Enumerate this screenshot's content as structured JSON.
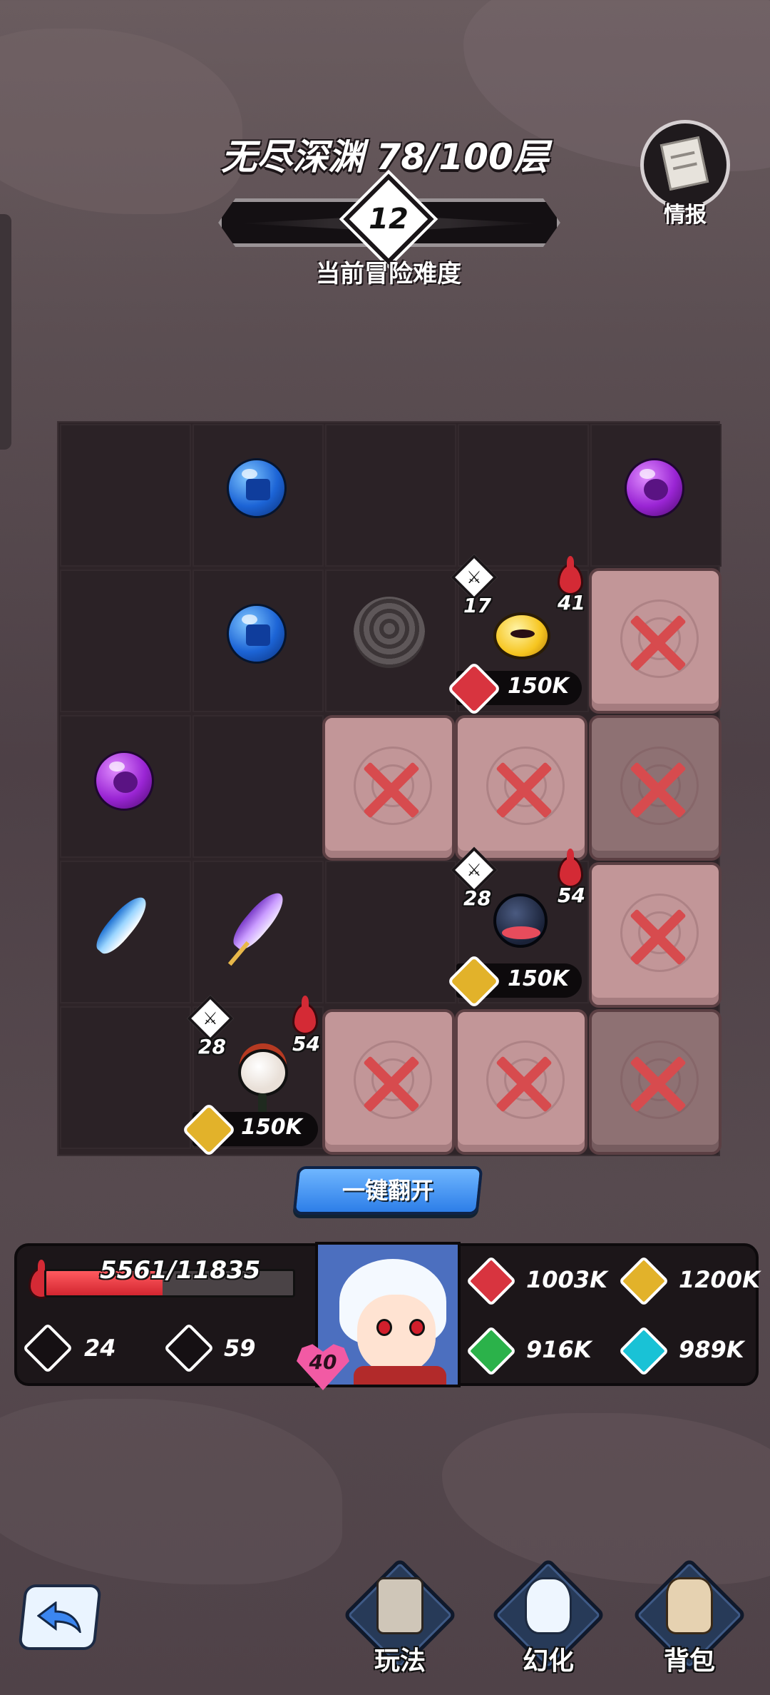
{
  "header": {
    "title": "无尽深渊 78/100层",
    "difficulty_value": "12",
    "difficulty_label": "当前冒险难度",
    "intel_label": "情报"
  },
  "grid": {
    "enemies": [
      {
        "attack": "17",
        "hp": "41",
        "power": "150K",
        "power_icon": "fang-icon",
        "kind": "lantern"
      },
      {
        "attack": "28",
        "hp": "54",
        "power": "150K",
        "power_icon": "flame-icon",
        "kind": "spider"
      },
      {
        "attack": "28",
        "hp": "54",
        "power": "150K",
        "power_icon": "flame-icon",
        "kind": "piranha-plant"
      }
    ]
  },
  "flip_all_button": "一键翻开",
  "player": {
    "hp_text": "5561/11835",
    "hp_fraction": 0.47,
    "attack": "24",
    "bonus_attack": "59",
    "level": "40",
    "stats": [
      {
        "icon": "fang-icon",
        "value": "1003K",
        "color": "#d8343f"
      },
      {
        "icon": "flame-icon",
        "value": "1200K",
        "color": "#e2b22a"
      },
      {
        "icon": "eye-icon",
        "value": "916K",
        "color": "#2bb24a"
      },
      {
        "icon": "wave-icon",
        "value": "989K",
        "color": "#19c2d6"
      }
    ]
  },
  "nav": {
    "items": [
      {
        "label": "玩法",
        "icon": "scroll-icon"
      },
      {
        "label": "幻化",
        "icon": "spirit-icon"
      },
      {
        "label": "背包",
        "icon": "bag-icon"
      }
    ]
  },
  "colors": {
    "accent_blue": "#2d7ee8",
    "hp_red": "#d22630",
    "card": "#c29698"
  }
}
